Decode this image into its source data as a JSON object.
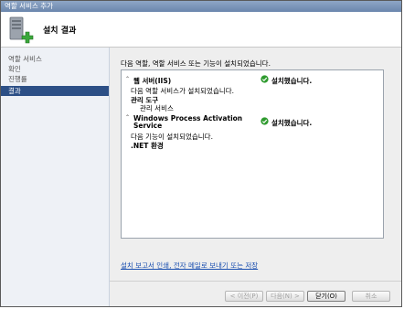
{
  "window": {
    "title": "역할 서비스 추가"
  },
  "header": {
    "title": "설치 결과"
  },
  "sidebar": {
    "items": [
      {
        "label": "역할 서비스"
      },
      {
        "label": "확인"
      },
      {
        "label": "진행률"
      },
      {
        "label": "결과",
        "active": true
      }
    ]
  },
  "main": {
    "intro": "다음 역할, 역할 서비스 또는 기능이 설치되었습니다.",
    "results": [
      {
        "name": "웹 서버(IIS)",
        "status": "설치했습니다.",
        "lines": [
          "다음 역할 서비스가 설치되었습니다."
        ],
        "group": "관리 도구",
        "items": [
          "관리 서비스"
        ]
      },
      {
        "name_line1": "Windows Process Activation",
        "name_line2": "Service",
        "status": "설치했습니다.",
        "lines": [
          "다음 기능이 설치되었습니다."
        ],
        "group": ".NET 환경"
      }
    ],
    "report_link": "설치 보고서 인쇄, 전자 메일로 보내기 또는 저장"
  },
  "buttons": {
    "prev": "< 이전(P)",
    "next": "다음(N) >",
    "close": "닫기(O)",
    "cancel": "취소"
  },
  "colors": {
    "accent": "#2c4f86",
    "success": "#2e9a2e",
    "link": "#1a4fb0"
  }
}
